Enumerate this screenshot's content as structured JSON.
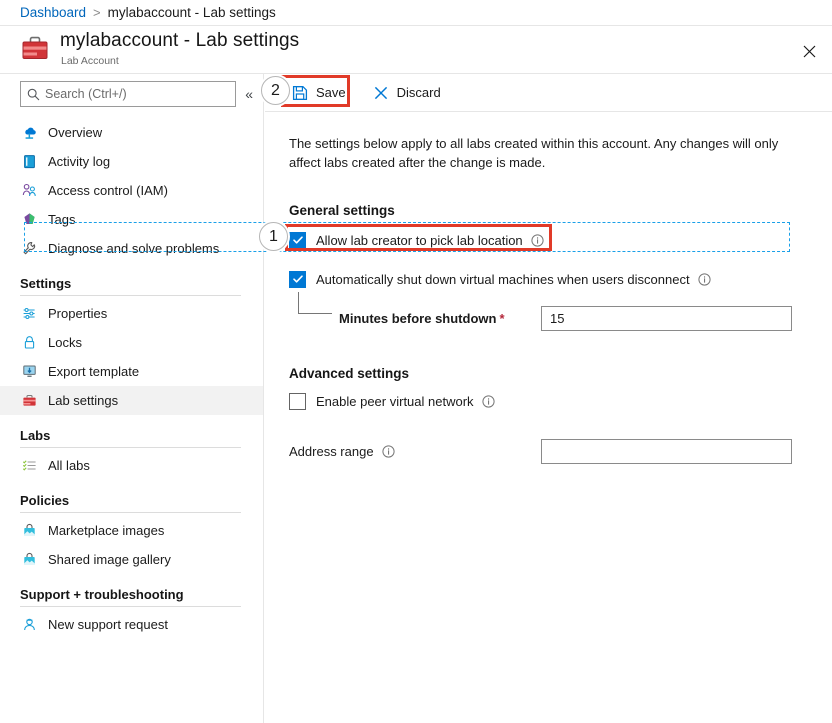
{
  "breadcrumb": {
    "root": "Dashboard",
    "separator": ">",
    "current": "mylabaccount - Lab settings"
  },
  "header": {
    "title": "mylabaccount - Lab settings",
    "subtitle": "Lab Account",
    "icon": "toolbox-icon",
    "close_icon": "close-icon"
  },
  "search": {
    "placeholder": "Search (Ctrl+/)",
    "value": "",
    "icon": "search-icon",
    "collapse_icon": "double-chevron-left-icon"
  },
  "sidebar": {
    "items": [
      {
        "label": "Overview",
        "icon": "cloud-overview-icon",
        "selected": false
      },
      {
        "label": "Activity log",
        "icon": "activity-log-icon",
        "selected": false
      },
      {
        "label": "Access control (IAM)",
        "icon": "access-control-icon",
        "selected": false
      },
      {
        "label": "Tags",
        "icon": "tags-icon",
        "selected": false
      },
      {
        "label": "Diagnose and solve problems",
        "icon": "wrench-icon",
        "selected": false
      }
    ],
    "groups": [
      {
        "title": "Settings",
        "items": [
          {
            "label": "Properties",
            "icon": "properties-icon",
            "selected": false
          },
          {
            "label": "Locks",
            "icon": "lock-icon",
            "selected": false
          },
          {
            "label": "Export template",
            "icon": "export-template-icon",
            "selected": false
          },
          {
            "label": "Lab settings",
            "icon": "toolbox-icon",
            "selected": true
          }
        ]
      },
      {
        "title": "Labs",
        "items": [
          {
            "label": "All labs",
            "icon": "all-labs-icon",
            "selected": false
          }
        ]
      },
      {
        "title": "Policies",
        "items": [
          {
            "label": "Marketplace images",
            "icon": "marketplace-icon",
            "selected": false
          },
          {
            "label": "Shared image gallery",
            "icon": "shared-gallery-icon",
            "selected": false
          }
        ]
      },
      {
        "title": "Support + troubleshooting",
        "items": [
          {
            "label": "New support request",
            "icon": "support-person-icon",
            "selected": false
          }
        ]
      }
    ]
  },
  "toolbar": {
    "save_label": "Save",
    "save_icon": "save-floppy-icon",
    "discard_label": "Discard",
    "discard_icon": "discard-x-icon"
  },
  "main": {
    "intro": "The settings below apply to all labs created within this account. Any changes will only affect labs created after the change is made.",
    "general_section_title": "General settings",
    "advanced_section_title": "Advanced settings",
    "allow_location": {
      "label": "Allow lab creator to pick lab location",
      "checked": true,
      "info_icon": "info-icon"
    },
    "auto_shutdown": {
      "label": "Automatically shut down virtual machines when users disconnect",
      "checked": true,
      "info_icon": "info-icon"
    },
    "minutes_before_shutdown": {
      "label": "Minutes before shutdown",
      "required_marker": "*",
      "value": "15",
      "placeholder": ""
    },
    "enable_peer_vnet": {
      "label": "Enable peer virtual network",
      "checked": false,
      "info_icon": "info-icon"
    },
    "address_range": {
      "label": "Address range",
      "value": "",
      "placeholder": "",
      "info_icon": "info-icon"
    }
  },
  "annotations": {
    "badge_1": "1",
    "badge_2": "2",
    "highlight_color": "#e13a28",
    "focus_color": "#1aa0e8"
  },
  "colors": {
    "accent_blue": "#0078d4",
    "link_blue": "#0066bb",
    "selected_bg": "#f2f2f2",
    "required_red": "#b4273a"
  }
}
